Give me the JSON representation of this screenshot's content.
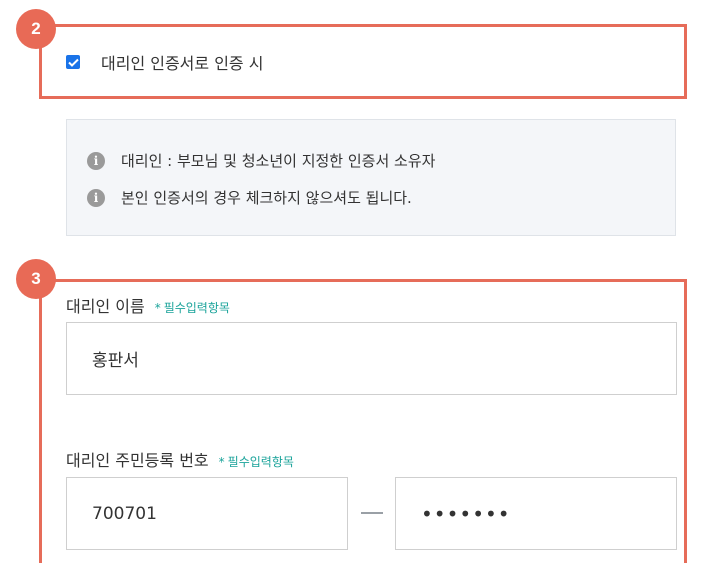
{
  "steps": {
    "agent_cert": "2",
    "agent_info": "3"
  },
  "agent_checkbox": {
    "label": "대리인 인증서로 인증 시",
    "checked": true
  },
  "notice": {
    "items": [
      "대리인 : 부모님 및 청소년이 지정한 인증서 소유자",
      "본인 인증서의 경우 체크하지 않으셔도 됩니다."
    ],
    "icon": "info-icon"
  },
  "fields": {
    "name": {
      "label": "대리인 이름",
      "required": "필수입력항목",
      "value": "홍판서"
    },
    "rrn": {
      "label": "대리인 주민등록 번호",
      "required": "필수입력항목",
      "front": "700701",
      "back": "•••••••"
    }
  },
  "colors": {
    "accent_red": "#e66c59",
    "badge": "#e86a56",
    "required_teal": "#1aa39a",
    "checkbox_blue": "#1a73e8"
  }
}
